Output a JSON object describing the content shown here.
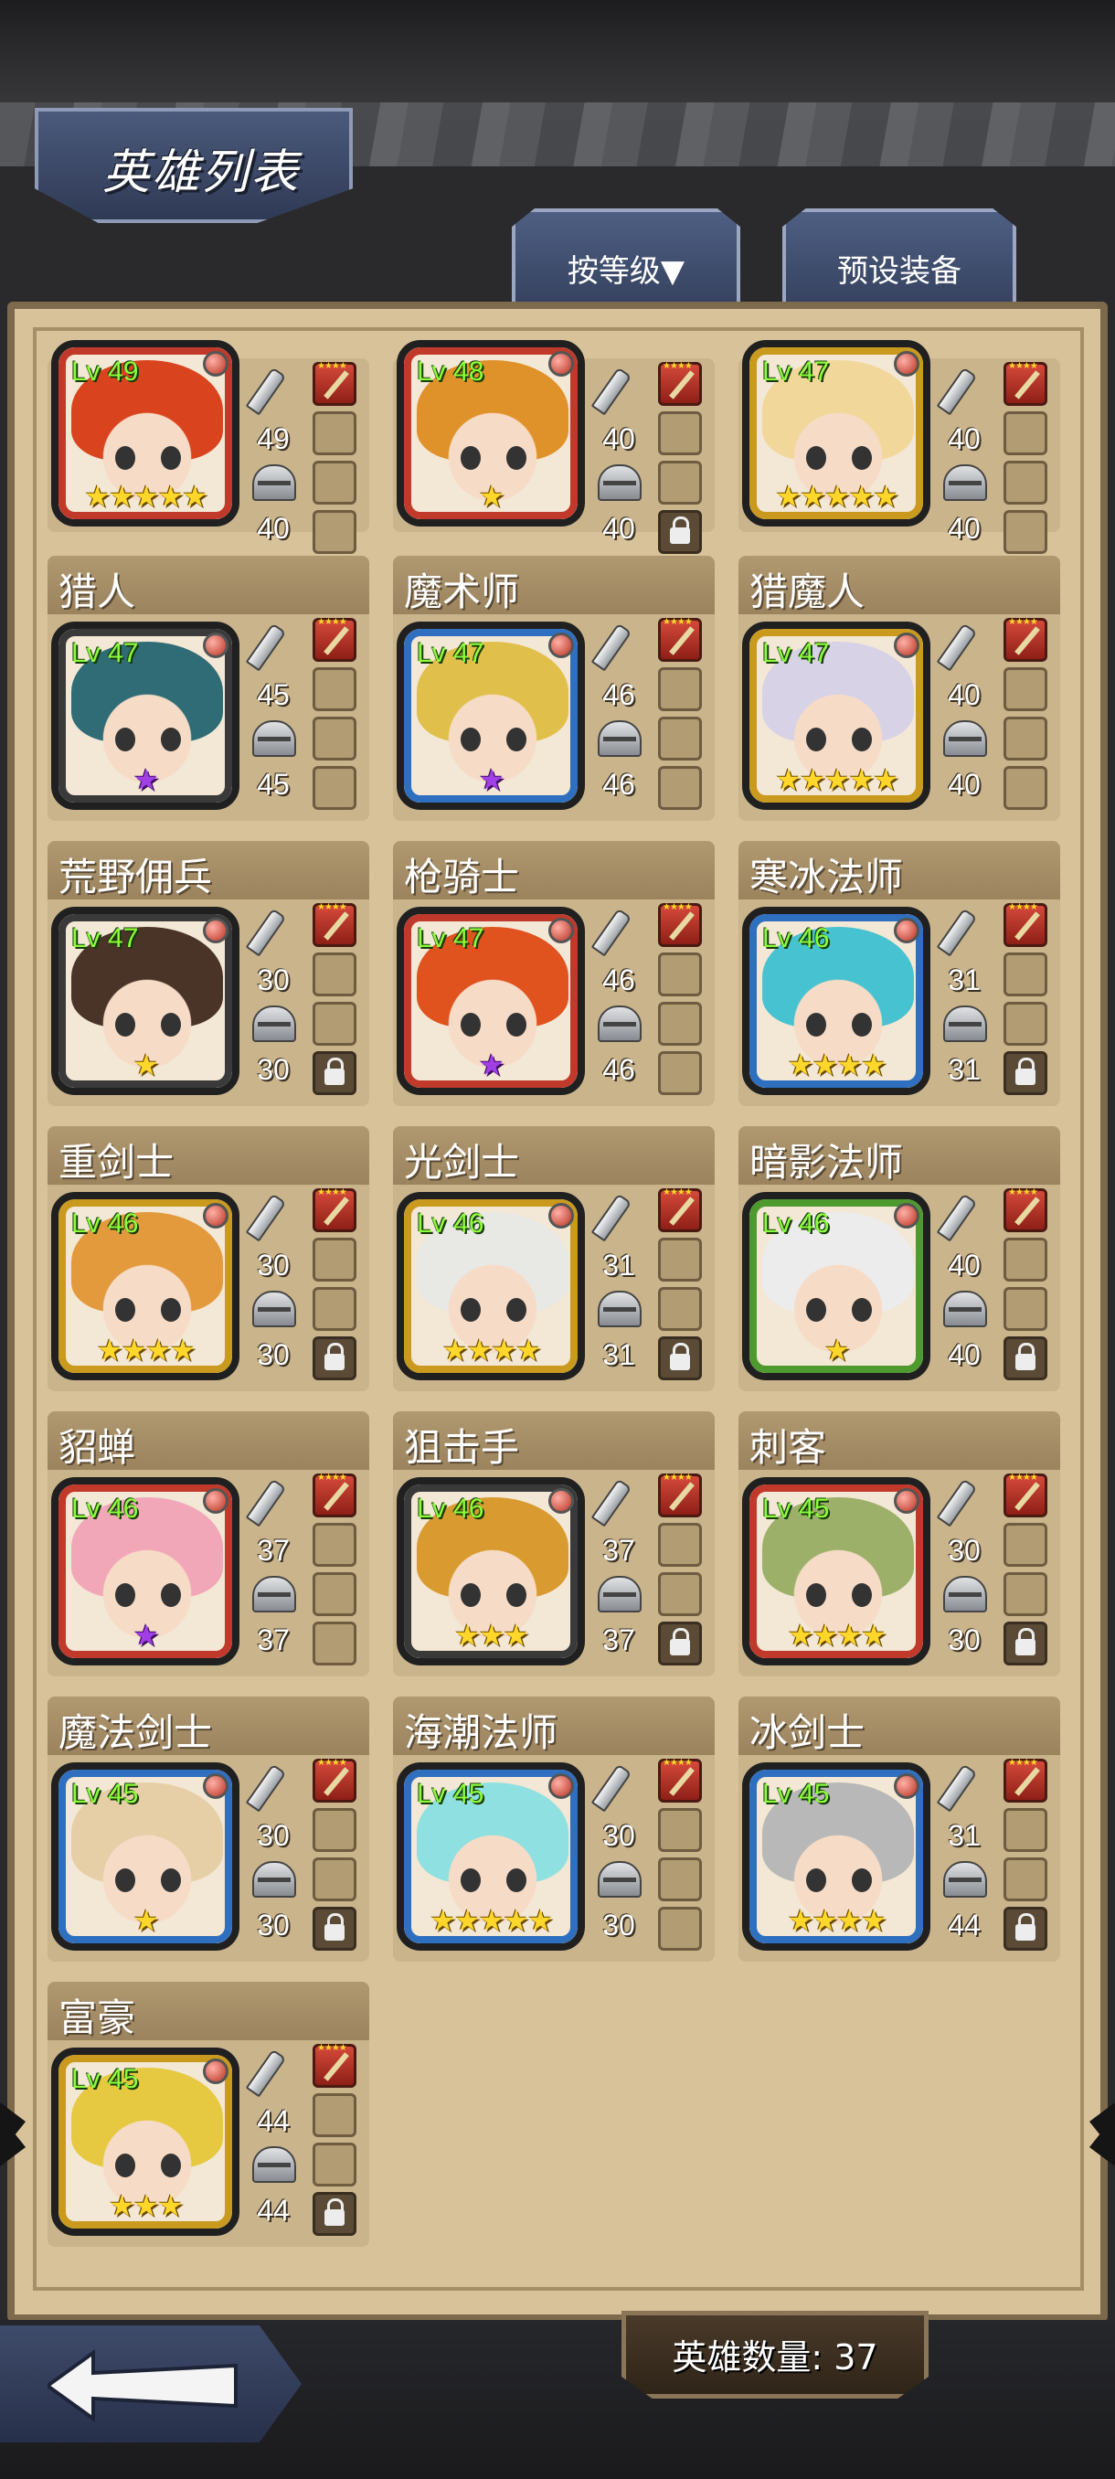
{
  "header": {
    "title": "英雄列表",
    "tabs": [
      {
        "label": "按等级▼"
      },
      {
        "label": "预设装备"
      }
    ]
  },
  "top_partial_heroes": [
    {
      "level": "Lv 49",
      "atk": "49",
      "def": "40",
      "stars": "★★★★★",
      "star_color": "gold",
      "frame": "#c0392b",
      "hair": "#d9441e",
      "locked": false
    },
    {
      "level": "Lv 48",
      "atk": "40",
      "def": "40",
      "stars": "★",
      "star_color": "gold",
      "frame": "#c0392b",
      "hair": "#e0922a",
      "locked": true
    },
    {
      "level": "Lv 47",
      "atk": "40",
      "def": "40",
      "stars": "★★★★★",
      "star_color": "gold",
      "frame": "#c99a1e",
      "hair": "#f1d89a",
      "locked": false
    }
  ],
  "heroes": [
    {
      "name": "猎人",
      "level": "Lv 47",
      "atk": "45",
      "def": "45",
      "stars": "★",
      "star_color": "purple",
      "frame": "#3a3a3a",
      "hair": "#2f6c76",
      "locked": false
    },
    {
      "name": "魔术师",
      "level": "Lv 47",
      "atk": "46",
      "def": "46",
      "stars": "★",
      "star_color": "purple",
      "frame": "#2f6fc0",
      "hair": "#e0c04a",
      "locked": false
    },
    {
      "name": "猎魔人",
      "level": "Lv 47",
      "atk": "40",
      "def": "40",
      "stars": "★★★★★",
      "star_color": "gold",
      "frame": "#c99a1e",
      "hair": "#d8d2e6",
      "locked": false
    },
    {
      "name": "荒野佣兵",
      "level": "Lv 47",
      "atk": "30",
      "def": "30",
      "stars": "★",
      "star_color": "gold",
      "frame": "#3a3a3a",
      "hair": "#4a3428",
      "locked": true
    },
    {
      "name": "枪骑士",
      "level": "Lv 47",
      "atk": "46",
      "def": "46",
      "stars": "★",
      "star_color": "purple",
      "frame": "#c0392b",
      "hair": "#e0521e",
      "locked": false
    },
    {
      "name": "寒冰法师",
      "level": "Lv 46",
      "atk": "31",
      "def": "31",
      "stars": "★★★★",
      "star_color": "gold",
      "frame": "#2f6fc0",
      "hair": "#47c2d0",
      "locked": true
    },
    {
      "name": "重剑士",
      "level": "Lv 46",
      "atk": "30",
      "def": "30",
      "stars": "★★★★",
      "star_color": "gold",
      "frame": "#c99a1e",
      "hair": "#e39a3c",
      "locked": true
    },
    {
      "name": "光剑士",
      "level": "Lv 46",
      "atk": "31",
      "def": "31",
      "stars": "★★★★",
      "star_color": "gold",
      "frame": "#c99a1e",
      "hair": "#e8e8e4",
      "locked": true
    },
    {
      "name": "暗影法师",
      "level": "Lv 46",
      "atk": "40",
      "def": "40",
      "stars": "★",
      "star_color": "gold",
      "frame": "#4f9a2e",
      "hair": "#ececec",
      "locked": true
    },
    {
      "name": "貂蝉",
      "level": "Lv 46",
      "atk": "37",
      "def": "37",
      "stars": "★",
      "star_color": "purple",
      "frame": "#c0392b",
      "hair": "#f2a7b8",
      "locked": false
    },
    {
      "name": "狙击手",
      "level": "Lv 46",
      "atk": "37",
      "def": "37",
      "stars": "★★★",
      "star_color": "gold",
      "frame": "#3a3a3a",
      "hair": "#d99a30",
      "locked": true
    },
    {
      "name": "刺客",
      "level": "Lv 45",
      "atk": "30",
      "def": "30",
      "stars": "★★★★",
      "star_color": "gold",
      "frame": "#c0392b",
      "hair": "#9db06a",
      "locked": true
    },
    {
      "name": "魔法剑士",
      "level": "Lv 45",
      "atk": "30",
      "def": "30",
      "stars": "★",
      "star_color": "gold",
      "frame": "#2f6fc0",
      "hair": "#e6cfa6",
      "locked": true
    },
    {
      "name": "海潮法师",
      "level": "Lv 45",
      "atk": "30",
      "def": "30",
      "stars": "★★★★★",
      "star_color": "gold",
      "frame": "#2f6fc0",
      "hair": "#8fe0e0",
      "locked": false
    },
    {
      "name": "冰剑士",
      "level": "Lv 45",
      "atk": "31",
      "def": "44",
      "stars": "★★★★",
      "star_color": "gold",
      "frame": "#2f6fc0",
      "hair": "#b8b8b8",
      "locked": true
    },
    {
      "name": "富豪",
      "level": "Lv 45",
      "atk": "44",
      "def": "44",
      "stars": "★★★",
      "star_color": "gold",
      "frame": "#c99a1e",
      "hair": "#e6c940",
      "locked": true
    }
  ],
  "footer": {
    "hero_count": "英雄数量: 37"
  },
  "icons": {
    "attack": "sword-icon",
    "defense": "helmet-icon",
    "lock": "lock-icon",
    "back": "back-arrow-icon"
  }
}
